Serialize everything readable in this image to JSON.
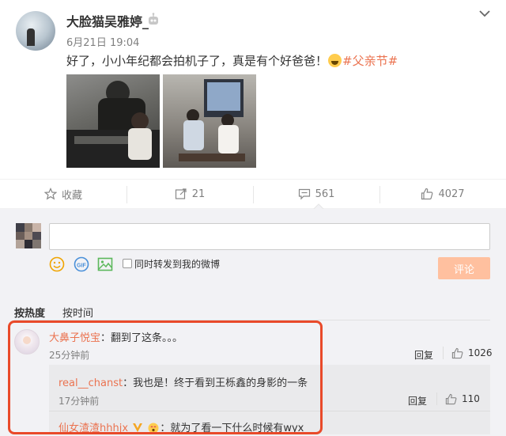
{
  "post": {
    "username": "大脸猫吴雅婷_",
    "time": "6月21日 19:04",
    "text": "好了，小小年纪都会拍机子了，真是有个好爸爸！",
    "hashtag": "#父亲节#",
    "icons": {
      "bot": "robot-icon",
      "menu": "chevron-down-icon",
      "emoji": "laughing-emoji-icon"
    }
  },
  "actions": {
    "favorite": "收藏",
    "repost": "21",
    "comment": "561",
    "like": "4027"
  },
  "composer": {
    "sync_label": "同时转发到我的微博",
    "submit_label": "评论",
    "tools": [
      "emoji-icon",
      "gif-icon",
      "image-icon"
    ]
  },
  "sort": {
    "hot": "按热度",
    "time": "按时间"
  },
  "comments": [
    {
      "name": "大鼻子悦宝",
      "text": "：翻到了这条。。。",
      "time": "25分钟前",
      "reply": "回复",
      "likes": "1026",
      "replies": [
        {
          "name": "real__chanst",
          "text": "：我也是！终于看到王栎鑫的身影的一条",
          "time": "17分钟前",
          "reply": "回复",
          "likes": "110"
        },
        {
          "name": "仙女渣渣hhhjx",
          "text": "：就为了看一下什么时候有wyx"
        }
      ]
    }
  ],
  "colors": {
    "accent": "#eb7350",
    "highlight": "#e94a2a",
    "submit_disabled": "#ffc09f"
  }
}
